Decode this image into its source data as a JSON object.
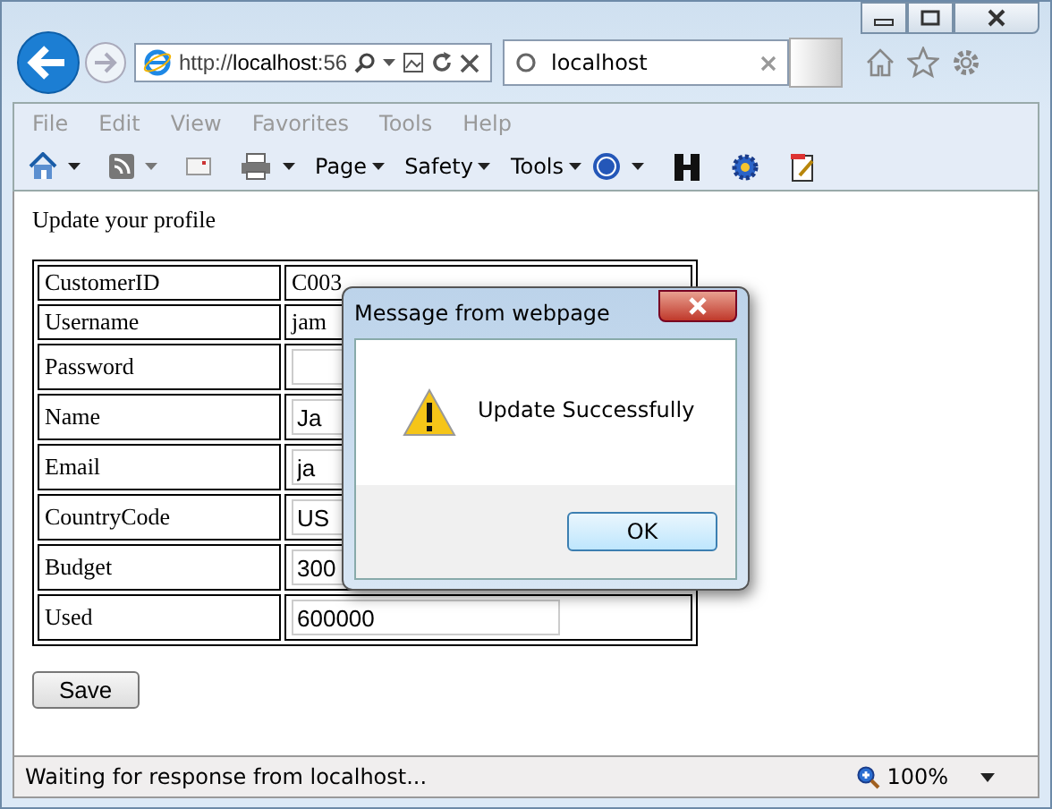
{
  "browser": {
    "address": {
      "prefix": "http://",
      "host": "localhost",
      "rest": ":56"
    },
    "tab": {
      "title": "localhost"
    },
    "menu": [
      "File",
      "Edit",
      "View",
      "Favorites",
      "Tools",
      "Help"
    ],
    "commands": [
      "Page",
      "Safety",
      "Tools"
    ]
  },
  "page": {
    "heading": "Update your profile",
    "rows": [
      {
        "label": "CustomerID",
        "kind": "text",
        "value": "C003"
      },
      {
        "label": "Username",
        "kind": "text",
        "value": "jam"
      },
      {
        "label": "Password",
        "kind": "input",
        "value": ""
      },
      {
        "label": "Name",
        "kind": "input",
        "value": "Ja"
      },
      {
        "label": "Email",
        "kind": "input",
        "value": "ja"
      },
      {
        "label": "CountryCode",
        "kind": "input",
        "value": "US"
      },
      {
        "label": "Budget",
        "kind": "input",
        "value": "300"
      },
      {
        "label": "Used",
        "kind": "input",
        "value": "600000"
      }
    ],
    "save": "Save"
  },
  "dialog": {
    "title": "Message from webpage",
    "message": "Update Successfully",
    "ok": "OK"
  },
  "status_bar": {
    "text": "Waiting for response from localhost...",
    "zoom": "100%"
  }
}
